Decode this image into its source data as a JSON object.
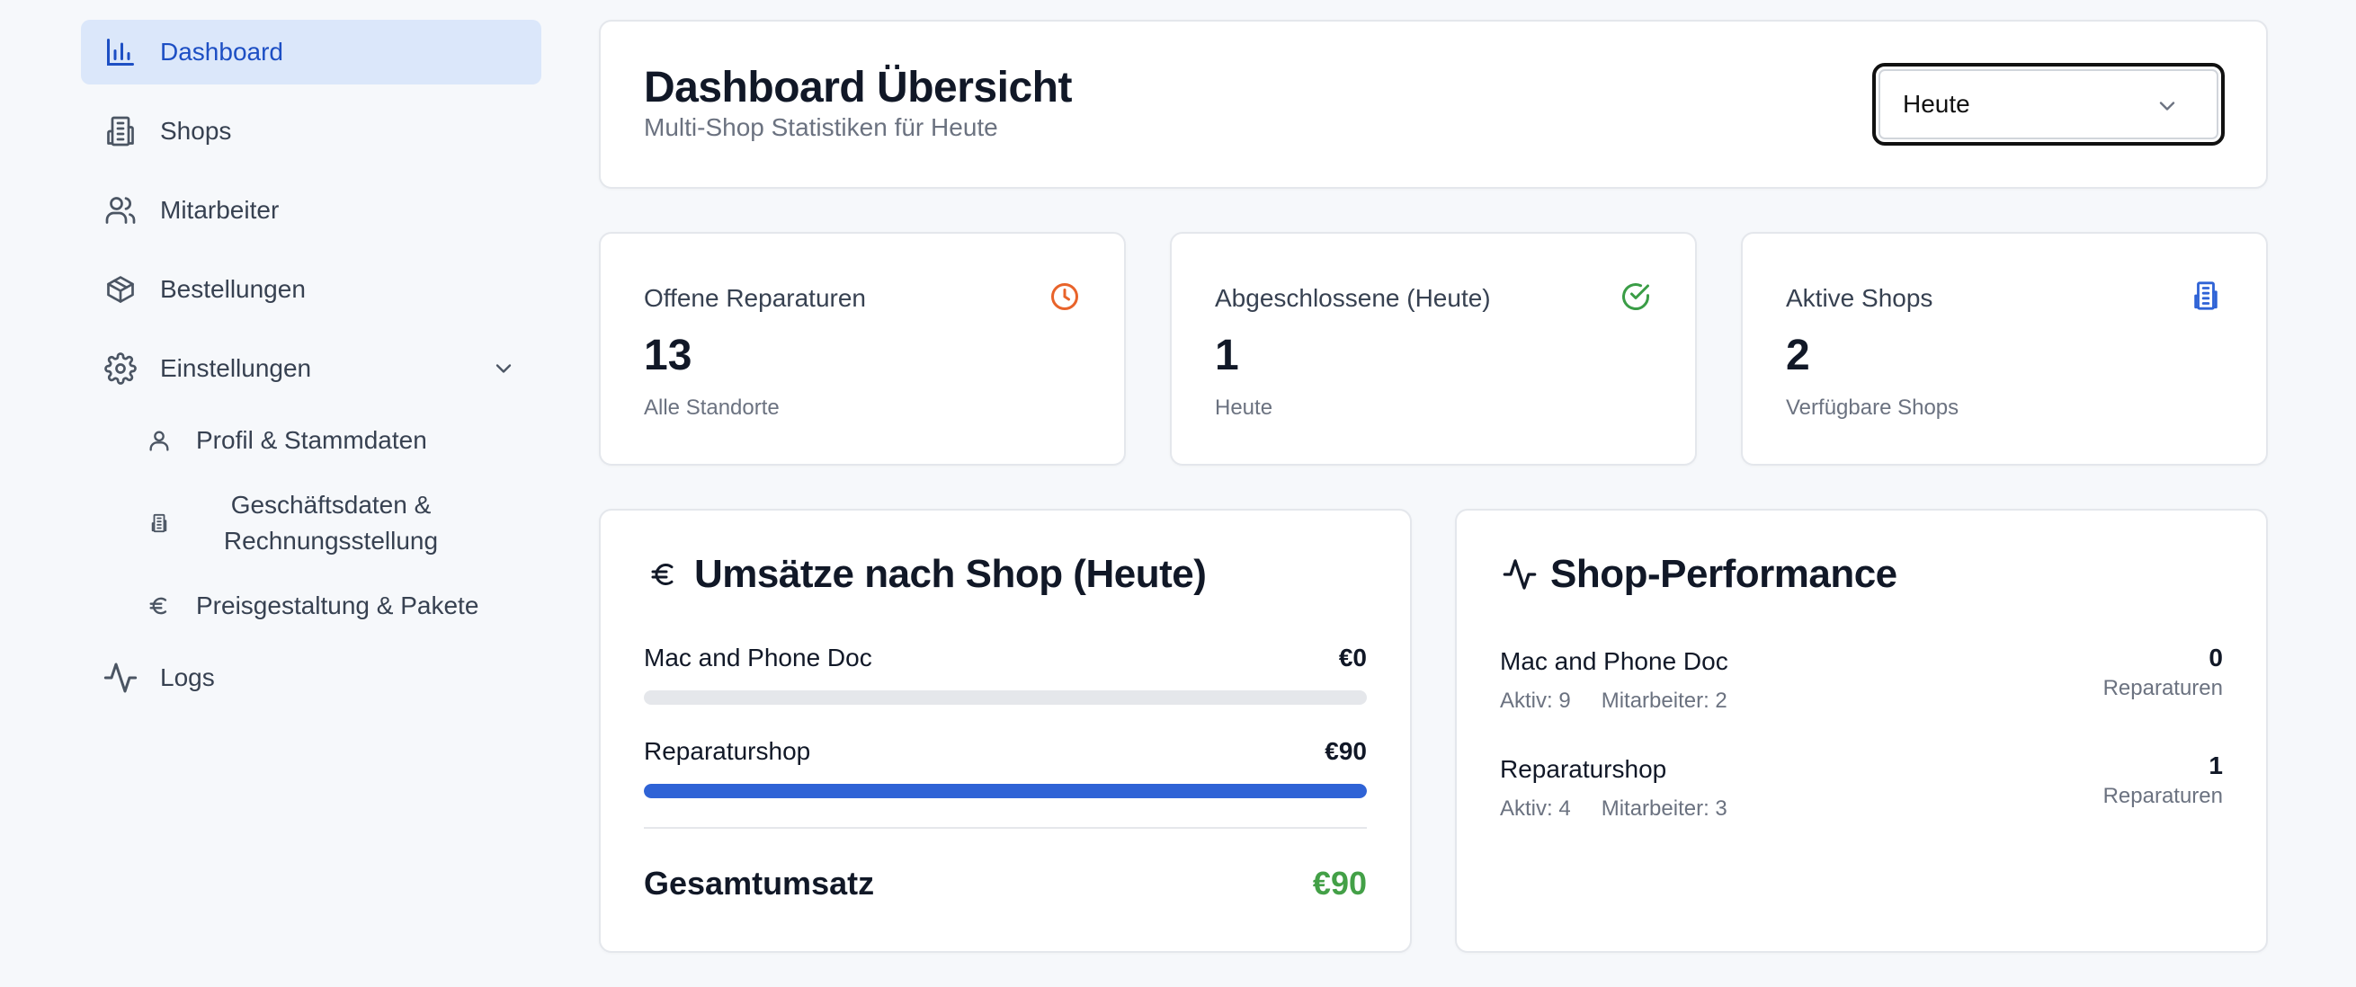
{
  "sidebar": {
    "items": [
      {
        "label": "Dashboard",
        "icon": "bar-chart-icon",
        "active": true
      },
      {
        "label": "Shops",
        "icon": "building-icon"
      },
      {
        "label": "Mitarbeiter",
        "icon": "users-icon"
      },
      {
        "label": "Bestellungen",
        "icon": "package-icon"
      },
      {
        "label": "Einstellungen",
        "icon": "gear-icon",
        "expanded": true
      },
      {
        "label": "Logs",
        "icon": "activity-icon"
      }
    ],
    "subitems": [
      {
        "label": "Profil & Stammdaten",
        "icon": "user-icon"
      },
      {
        "label_line1": "Geschäftsdaten &",
        "label_line2": "Rechnungsstellung",
        "icon": "building-icon"
      },
      {
        "label": "Preisgestaltung & Pakete",
        "icon": "euro-icon"
      }
    ]
  },
  "header": {
    "title": "Dashboard Übersicht",
    "subtitle": "Multi-Shop Statistiken für Heute",
    "period_select": "Heute"
  },
  "stats": [
    {
      "label": "Offene Reparaturen",
      "value": "13",
      "caption": "Alle Standorte",
      "icon": "clock-icon",
      "color": "#e8632a"
    },
    {
      "label": "Abgeschlossene (Heute)",
      "value": "1",
      "caption": "Heute",
      "icon": "check-circle-icon",
      "color": "#3a9d46"
    },
    {
      "label": "Aktive Shops",
      "value": "2",
      "caption": "Verfügbare Shops",
      "icon": "building-icon",
      "color": "#2f63d6"
    }
  ],
  "revenue": {
    "title": "Umsätze nach Shop (Heute)",
    "rows": [
      {
        "name": "Mac and Phone Doc",
        "amount": "€0",
        "share": 0
      },
      {
        "name": "Reparaturshop",
        "amount": "€90",
        "share": 1
      }
    ],
    "total_label": "Gesamtumsatz",
    "total_value": "€90"
  },
  "performance": {
    "title": "Shop-Performance",
    "rows": [
      {
        "name": "Mac and Phone Doc",
        "aktiv": "Aktiv: 9",
        "mitarbeiter": "Mitarbeiter: 2",
        "count": "0",
        "unit": "Reparaturen"
      },
      {
        "name": "Reparaturshop",
        "aktiv": "Aktiv: 4",
        "mitarbeiter": "Mitarbeiter: 3",
        "count": "1",
        "unit": "Reparaturen"
      }
    ]
  },
  "colors": {
    "accent": "#2f63d6",
    "active_bg": "#dbe7fa",
    "success": "#43a047",
    "warning": "#e8632a"
  }
}
